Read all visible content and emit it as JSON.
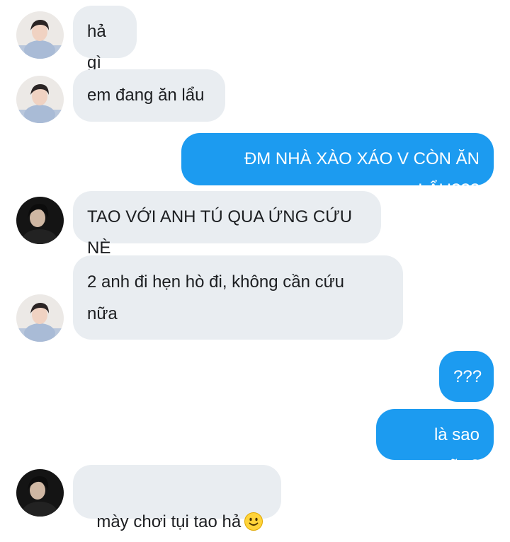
{
  "messages": [
    {
      "id": "m1",
      "sender": "light-avatar",
      "text": "hả gì"
    },
    {
      "id": "m2",
      "sender": "light-avatar",
      "text": "em đang ăn lẩu"
    },
    {
      "id": "m3",
      "sender": "me",
      "text": "ĐM NHÀ XÀO XÁO V CÒN ĂN LẨU???"
    },
    {
      "id": "m4",
      "sender": "dark-avatar",
      "text": "TAO VỚI ANH TÚ QUA ỨNG CỨU NÈ"
    },
    {
      "id": "m5",
      "sender": "light-avatar",
      "text": "2 anh đi hẹn hò đi, không cần cứu\nnữa"
    },
    {
      "id": "m6",
      "sender": "me",
      "text": "???"
    },
    {
      "id": "m7",
      "sender": "me",
      "text": "là sao nữa?"
    },
    {
      "id": "m8",
      "sender": "dark-avatar",
      "text": "mày chơi tụi tao hả",
      "emoji": "slightly-smiling-face-icon"
    }
  ],
  "colors": {
    "incoming_bubble": "#e9edf1",
    "outgoing_bubble": "#1c9bf0",
    "incoming_text": "#1c1e21",
    "outgoing_text": "#ffffff",
    "background": "#ffffff"
  }
}
